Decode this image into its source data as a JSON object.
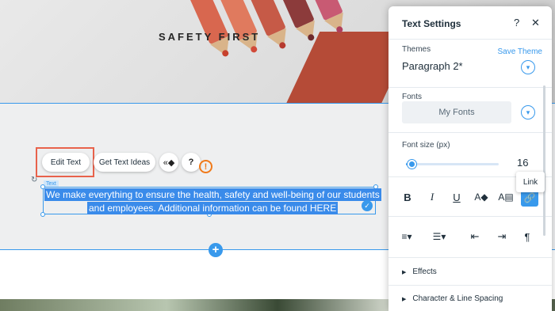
{
  "canvas": {
    "section_title": "SAFETY FIRST",
    "text_tag": "Text",
    "paragraph_line1": "We make everything to ensure the health, safety and well-being of our students",
    "paragraph_line2": "and employees. Additional information can be found HERE"
  },
  "toolbar": {
    "edit_text": "Edit Text",
    "get_text_ideas": "Get Text Ideas",
    "animation_glyph": "«◆",
    "help_glyph": "?",
    "warning_glyph": "!"
  },
  "panel": {
    "title": "Text Settings",
    "help_glyph": "?",
    "close_glyph": "✕",
    "themes_label": "Themes",
    "save_theme": "Save Theme",
    "theme_value": "Paragraph 2*",
    "fonts_label": "Fonts",
    "font_value": "My Fonts",
    "font_size_label": "Font size (px)",
    "font_size_value": "16",
    "font_size_fraction": 0.06,
    "format_buttons": [
      "B",
      "I",
      "U"
    ],
    "link_tooltip": "Link",
    "effects_label": "Effects",
    "spacing_label": "Character & Line Spacing"
  },
  "colors": {
    "accent": "#3899ec",
    "highlight_frame": "#e8624b",
    "warning": "#f07a1a"
  }
}
